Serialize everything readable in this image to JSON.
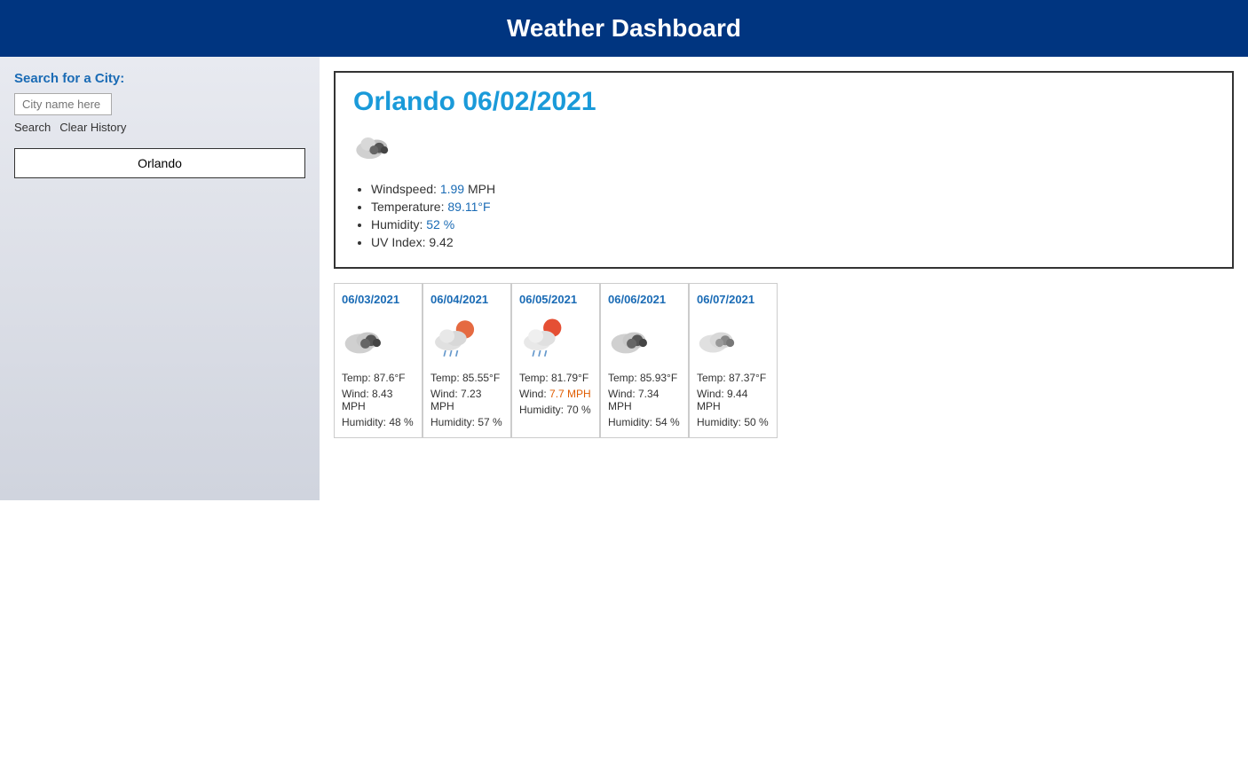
{
  "header": {
    "title": "Weather Dashboard"
  },
  "sidebar": {
    "title": "Search for a City:",
    "input_placeholder": "City name here",
    "search_label": "Search",
    "clear_history_label": "Clear History",
    "history_items": [
      "Orlando"
    ]
  },
  "today": {
    "city": "Orlando",
    "date": "06/02/2021",
    "windspeed_label": "Windspeed:",
    "windspeed_value": "1.99",
    "windspeed_unit": "MPH",
    "temperature_label": "Temperature:",
    "temperature_value": "89.11°F",
    "humidity_label": "Humidity:",
    "humidity_value": "52 %",
    "uv_label": "UV Index:",
    "uv_value": "9.42"
  },
  "forecast": [
    {
      "date": "06/03/2021",
      "icon": "cloudy-dark",
      "temp": "Temp: 87.6°F",
      "wind": "Wind: 8.43 MPH",
      "humidity": "Humidity: 48 %"
    },
    {
      "date": "06/04/2021",
      "icon": "rain-sun",
      "temp": "Temp: 85.55°F",
      "wind": "Wind: 7.23 MPH",
      "humidity": "Humidity: 57 %"
    },
    {
      "date": "06/05/2021",
      "icon": "rain-sun2",
      "temp": "Temp: 81.79°F",
      "wind": "Wind: 7.7 MPH",
      "humidity": "Humidity: 70 %",
      "wind_highlight": true
    },
    {
      "date": "06/06/2021",
      "icon": "cloudy-dark",
      "temp": "Temp: 85.93°F",
      "wind": "Wind: 7.34 MPH",
      "humidity": "Humidity: 54 %"
    },
    {
      "date": "06/07/2021",
      "icon": "cloudy-light",
      "temp": "Temp: 87.37°F",
      "wind": "Wind: 9.44 MPH",
      "humidity": "Humidity: 50 %"
    }
  ]
}
